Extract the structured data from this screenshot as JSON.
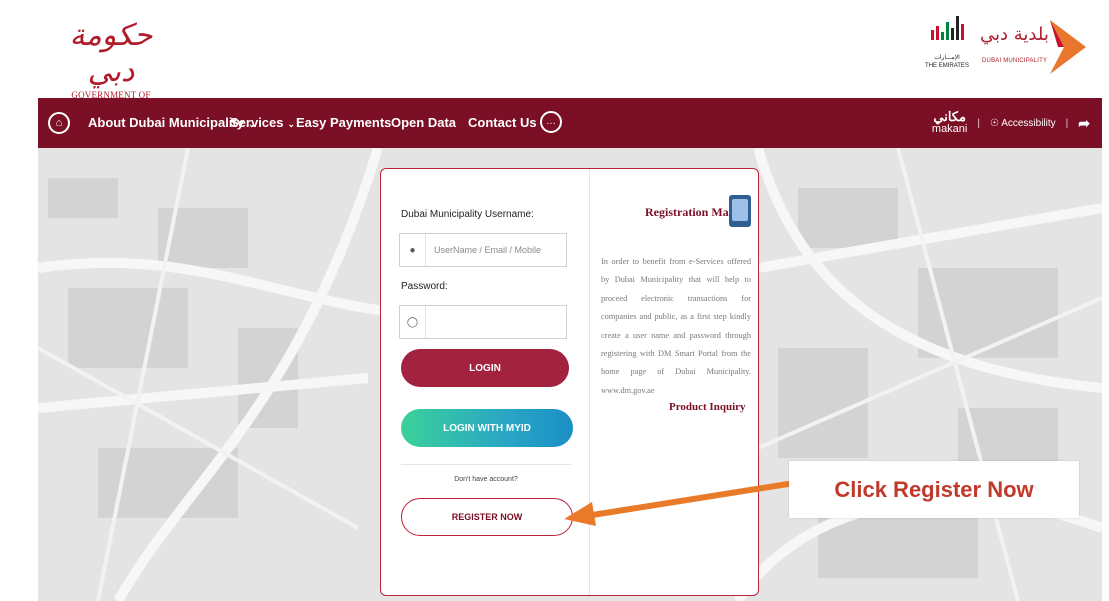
{
  "header": {
    "gov_logo_arabic": "حكومة دبي",
    "gov_logo_text": "GOVERNMENT OF DUBAI",
    "uae_logo_caption_ar": "الإمـــارات",
    "uae_logo_caption_en": "THE EMIRATES",
    "dm_logo_arabic": "بلدية دبي",
    "dm_logo_text": "DUBAI MUNICIPALITY"
  },
  "nav": {
    "items": [
      {
        "label": "About Dubai Municipality"
      },
      {
        "label": "Services"
      },
      {
        "label": "Easy Payments"
      },
      {
        "label": "Open Data"
      },
      {
        "label": "Contact Us"
      }
    ],
    "makani_arabic": "مكاني",
    "makani_label": "makani",
    "accessibility": "Accessibility"
  },
  "login": {
    "username_label": "Dubai Municipality Username:",
    "username_placeholder": "UserName / Email / Mobile",
    "password_label": "Password:",
    "login_button": "LOGIN",
    "myid_button": "LOGIN WITH MYID",
    "no_account": "Don't have account?",
    "register_button": "REGISTER NOW"
  },
  "manual": {
    "title": "Registration Manual",
    "text": "In order to benefit from e-Services offered by Dubai Municipality that will help to proceed electronic transactions for companies and public, as a first step kindly create a user name and password through registering with DM Smart Portal from the home page of Dubai Municipality. www.dm.gov.ae",
    "product_inquiry": "Product Inquiry"
  },
  "annotation": {
    "callout": "Click Register Now"
  },
  "colors": {
    "brand": "#7a0f26",
    "login_button": "#a3233f",
    "callout_text": "#c0392b",
    "arrow": "#e87a2a"
  }
}
